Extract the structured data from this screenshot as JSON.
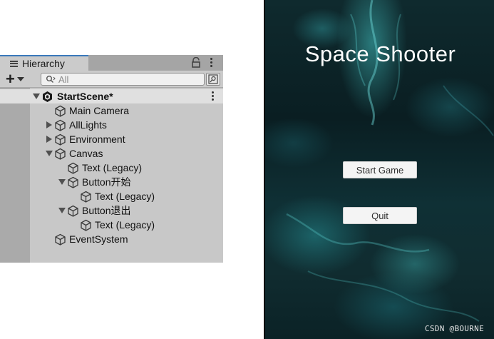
{
  "hierarchy": {
    "tab_title": "Hierarchy",
    "search_placeholder": "All",
    "add_label": "+",
    "scene": {
      "name": "StartScene*"
    },
    "items": [
      {
        "label": "Main Camera",
        "depth": 1,
        "expander": "none"
      },
      {
        "label": "AllLights",
        "depth": 1,
        "expander": "collapsed"
      },
      {
        "label": "Environment",
        "depth": 1,
        "expander": "collapsed"
      },
      {
        "label": "Canvas",
        "depth": 1,
        "expander": "expanded"
      },
      {
        "label": "Text (Legacy)",
        "depth": 2,
        "expander": "none"
      },
      {
        "label": "Button开始",
        "depth": 2,
        "expander": "expanded"
      },
      {
        "label": "Text (Legacy)",
        "depth": 3,
        "expander": "none"
      },
      {
        "label": "Button退出",
        "depth": 2,
        "expander": "expanded"
      },
      {
        "label": "Text (Legacy)",
        "depth": 3,
        "expander": "none"
      },
      {
        "label": "EventSystem",
        "depth": 1,
        "expander": "none"
      }
    ]
  },
  "game": {
    "title": "Space Shooter",
    "start_button": "Start Game",
    "quit_button": "Quit"
  },
  "watermark": "CSDN @BOURNE",
  "colors": {
    "panel_bg": "#c8c8c8",
    "tab_accent": "#3a79bb",
    "scene_row_bg": "#e0e0e0",
    "space_bg": "#0f2a2e",
    "nebula_accent": "#41bebe"
  },
  "icons": [
    "hierarchy-list-icon",
    "lock-icon",
    "kebab-menu-icon",
    "search-icon",
    "scene-search-icon",
    "unity-logo-icon",
    "gameobject-cube-icon"
  ]
}
